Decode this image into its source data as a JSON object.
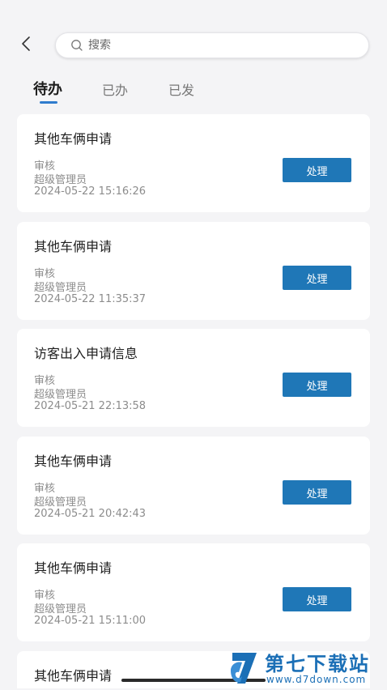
{
  "search": {
    "placeholder": "搜索"
  },
  "tabs": [
    {
      "label": "待办",
      "active": true
    },
    {
      "label": "已办",
      "active": false
    },
    {
      "label": "已发",
      "active": false
    }
  ],
  "items": [
    {
      "title": "其他车俩申请",
      "type": "审核",
      "user": "超级管理员",
      "time": "2024-05-22 15:16:26",
      "action": "处理"
    },
    {
      "title": "其他车俩申请",
      "type": "审核",
      "user": "超级管理员",
      "time": "2024-05-22 11:35:37",
      "action": "处理"
    },
    {
      "title": "访客出入申请信息",
      "type": "审核",
      "user": "超级管理员",
      "time": "2024-05-21 22:13:58",
      "action": "处理"
    },
    {
      "title": "其他车俩申请",
      "type": "审核",
      "user": "超级管理员",
      "time": "2024-05-21 20:42:43",
      "action": "处理"
    },
    {
      "title": "其他车俩申请",
      "type": "审核",
      "user": "超级管理员",
      "time": "2024-05-21 15:11:00",
      "action": "处理"
    },
    {
      "title": "其他车俩申请"
    }
  ],
  "watermark": {
    "title": "第七下载站",
    "url": "www.d7down.com"
  },
  "colors": {
    "accent": "#1f77b7",
    "tab_indicator": "#2f7ccd",
    "background": "#f4f4f6"
  }
}
